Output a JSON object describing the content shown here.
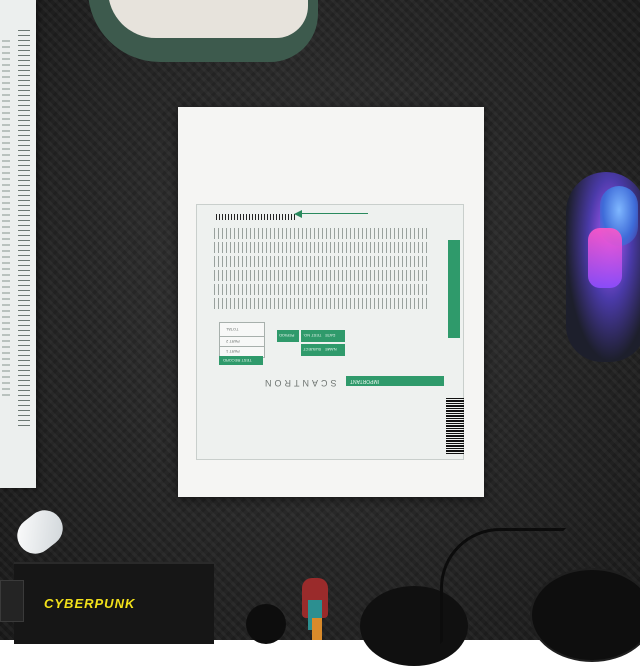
{
  "photo": {
    "scene": "desk-with-answer-sheet",
    "colors": {
      "desk": "#262626",
      "envelope": "#f5f5f3",
      "form_green": "#2f9a6b",
      "mouse_glow": "#b35cff",
      "brand_yellow": "#f2e11a"
    }
  },
  "form": {
    "brand": "SCANTRON",
    "header_banner": "IMPORTANT",
    "record_title": "TEST RECORD",
    "fields": [
      "NAME",
      "SUBJECT",
      "TEST NO.",
      "DATE",
      "PERIOD",
      "PART 1",
      "PART 2",
      "TOTAL"
    ]
  },
  "keyboard": {
    "brand": "CYBERPUNK"
  }
}
